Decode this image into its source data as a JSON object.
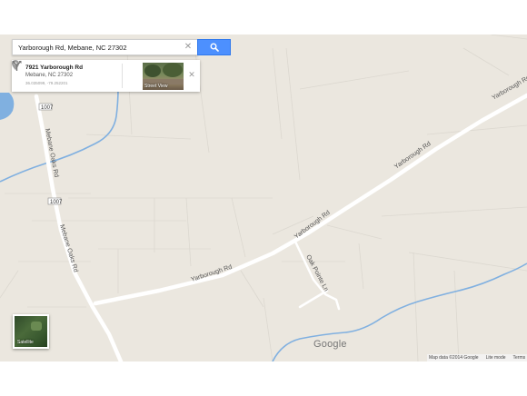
{
  "search": {
    "value": "Yarborough Rd, Mebane, NC 27302",
    "placeholder": ""
  },
  "info_card": {
    "name": "7921 Yarborough Rd",
    "address": "Mebane, NC 27302",
    "coords": "36.035099, -79.252201",
    "street_view_label": "Street View"
  },
  "map": {
    "background_color": "#ebe7df",
    "road_color": "#ffffff",
    "water_color": "#80b0e0",
    "road_labels": {
      "yarborough_1": "Yarborough Rd",
      "yarborough_2": "Yarborough Rd",
      "yarborough_3": "Yarborough Rd",
      "yarborough_4": "Yarborough Rd",
      "mebane_oaks_1": "Mebane Oaks Rd",
      "mebane_oaks_2": "Mebane Oaks Rd",
      "oak_pointe": "Oak Pointe Ln"
    },
    "route_shields": [
      "1007",
      "1007"
    ]
  },
  "satellite_toggle": {
    "label": "Satellite"
  },
  "watermark": "Google",
  "footer": {
    "map_data": "Map data ©2014 Google",
    "lite_mode": "Lite mode",
    "terms": "Terms"
  },
  "icons": [
    "pin-icon",
    "search-icon",
    "close-icon",
    "directions-icon"
  ]
}
